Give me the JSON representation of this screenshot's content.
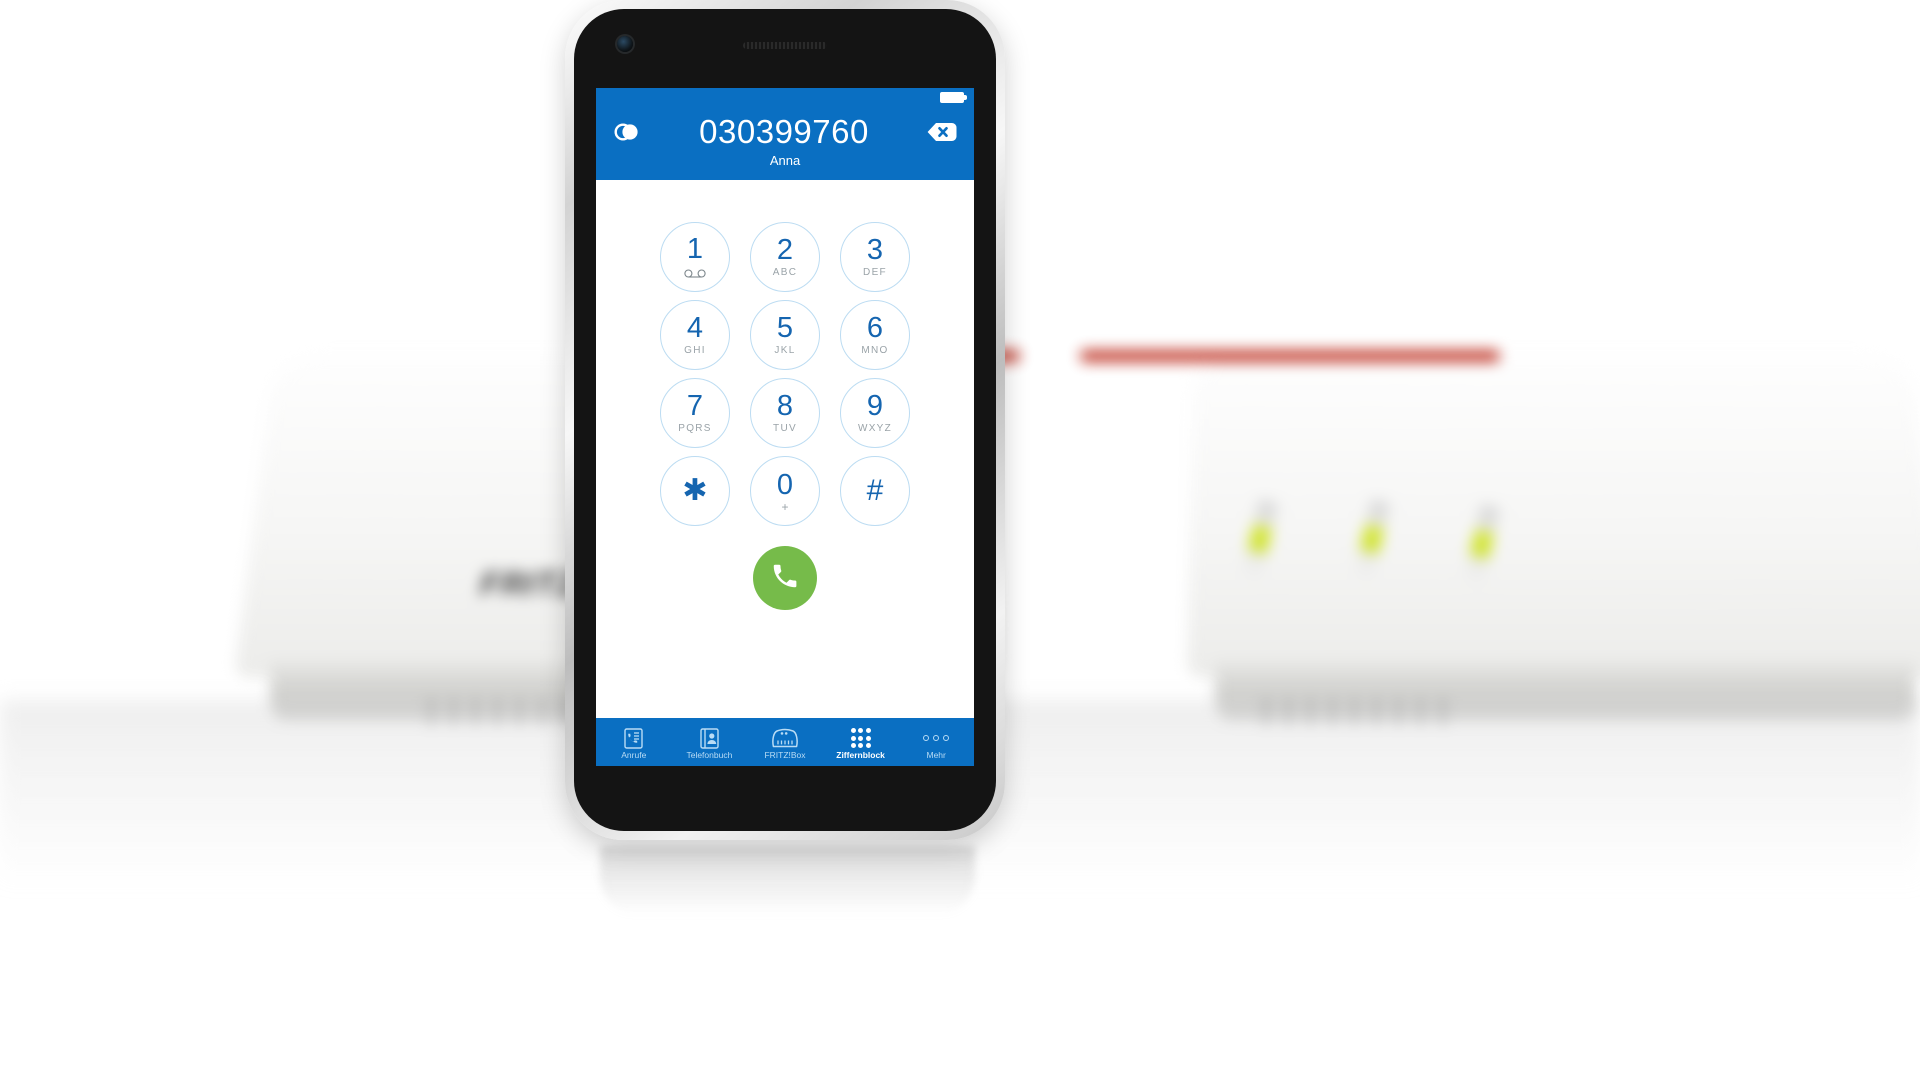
{
  "scene": {
    "background_product_label": "FRITZ!Box",
    "background_accent_color": "#c1392b",
    "background_led_color": "#cfe22f"
  },
  "app": {
    "brand_blue": "#0a6fc2",
    "call_green": "#76bb4a",
    "key_blue": "#1565b0",
    "statusbar": {
      "battery_icon": "battery-full-icon"
    },
    "header": {
      "number": "030399760",
      "contact_name": "Anna",
      "left_icon": "toggle-circles-icon",
      "clear_icon": "backspace-delete-icon"
    },
    "keypad": {
      "keys": [
        {
          "digit": "1",
          "sub": "",
          "icon": "voicemail-icon"
        },
        {
          "digit": "2",
          "sub": "ABC",
          "icon": ""
        },
        {
          "digit": "3",
          "sub": "DEF",
          "icon": ""
        },
        {
          "digit": "4",
          "sub": "GHI",
          "icon": ""
        },
        {
          "digit": "5",
          "sub": "JKL",
          "icon": ""
        },
        {
          "digit": "6",
          "sub": "MNO",
          "icon": ""
        },
        {
          "digit": "7",
          "sub": "PQRS",
          "icon": ""
        },
        {
          "digit": "8",
          "sub": "TUV",
          "icon": ""
        },
        {
          "digit": "9",
          "sub": "WXYZ",
          "icon": ""
        },
        {
          "digit": "✱",
          "sub": "",
          "icon": ""
        },
        {
          "digit": "0",
          "sub": "+",
          "icon": ""
        },
        {
          "digit": "#",
          "sub": "",
          "icon": ""
        }
      ],
      "call_button_icon": "phone-handset-icon"
    },
    "bottomnav": {
      "items": [
        {
          "label": "Anrufe",
          "icon": "call-list-icon",
          "active": false
        },
        {
          "label": "Telefonbuch",
          "icon": "address-book-icon",
          "active": false
        },
        {
          "label": "FRITZ!Box",
          "icon": "router-icon",
          "active": false
        },
        {
          "label": "Ziffernblock",
          "icon": "keypad-grid-icon",
          "active": true
        },
        {
          "label": "Mehr",
          "icon": "more-dots-icon",
          "active": false
        }
      ]
    }
  }
}
